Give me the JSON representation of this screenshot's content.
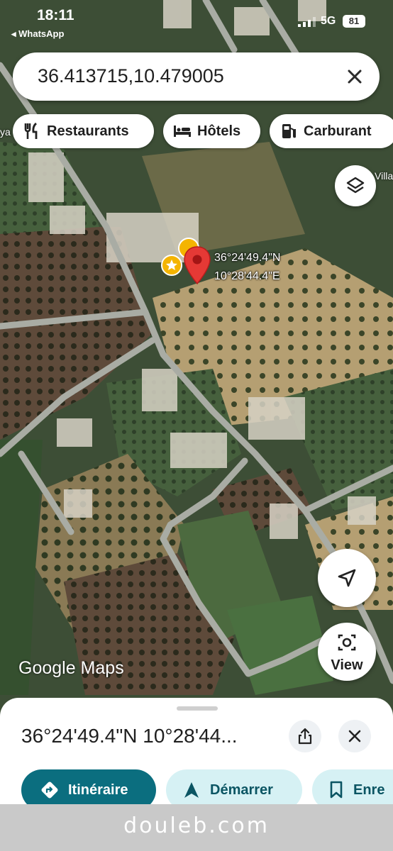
{
  "status": {
    "time": "18:11",
    "back_app": "◂ WhatsApp",
    "network": "5G",
    "battery": "81"
  },
  "search": {
    "query": "36.413715,10.479005"
  },
  "chips": [
    {
      "label": "Restaurants",
      "icon": "fork-knife-icon"
    },
    {
      "label": "Hôtels",
      "icon": "bed-icon"
    },
    {
      "label": "Carburant",
      "icon": "gas-station-icon"
    }
  ],
  "map": {
    "pin_lat": "36°24'49.4\"N",
    "pin_lng": "10°28'44.4\"E",
    "label_left": "ya",
    "label_right": "Villa",
    "logo": "Google Maps",
    "view_label": "View"
  },
  "sheet": {
    "title": "36°24'49.4\"N 10°28'44..."
  },
  "actions": [
    {
      "label": "Itinéraire",
      "icon": "directions-icon"
    },
    {
      "label": "Démarrer",
      "icon": "navigation-arrow-icon"
    },
    {
      "label": "Enre",
      "icon": "bookmark-icon"
    }
  ],
  "watermark": "douleb.com",
  "colors": {
    "accent_teal": "#0b6e7f",
    "chip_light": "#d6f1f4",
    "pin_red": "#e53935",
    "star_yellow": "#f4b400"
  }
}
